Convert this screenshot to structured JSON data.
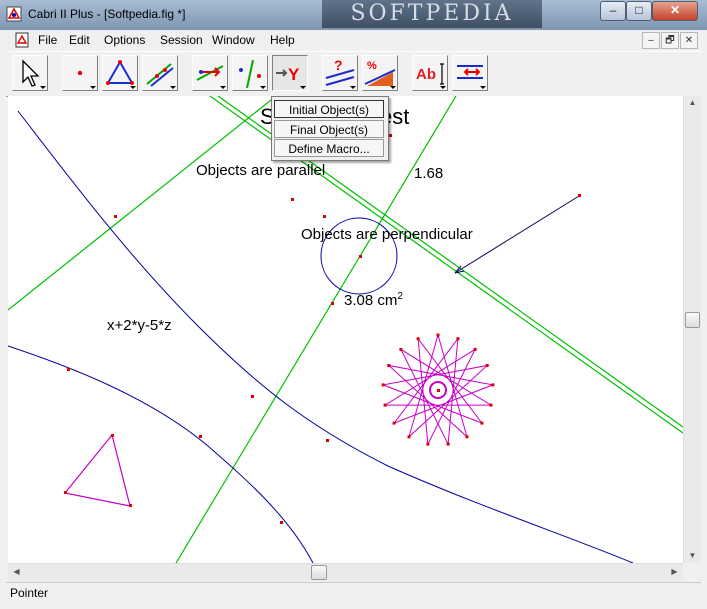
{
  "window": {
    "title": "Cabri II Plus - [Softpedia.fig *]",
    "watermark": "SOFTPEDIA",
    "controls": {
      "minimize": "–",
      "maximize": "□",
      "close": "✕"
    }
  },
  "menubar": {
    "items": [
      "File",
      "Edit",
      "Options",
      "Session",
      "Window",
      "Help"
    ],
    "mdi_controls": [
      "–",
      "🗗",
      "✕"
    ]
  },
  "toolbar": {
    "tools": [
      "pointer",
      "points",
      "lines",
      "curves",
      "constructions",
      "transformations",
      "macro",
      "check-property",
      "measure",
      "display",
      "drawing"
    ],
    "macro_menu": [
      "Initial Object(s)",
      "Final Object(s)",
      "Define Macro..."
    ]
  },
  "canvas": {
    "title_partial_left": "S",
    "title_partial_right": "est",
    "labels": {
      "parallel": "Objects are parallel",
      "perpendicular": "Objects are perpendicular",
      "distance": "1.68",
      "area_value": "3.08 cm",
      "area_exponent": "2",
      "equation": "x+2*y-5*z"
    },
    "colors": {
      "green": "#00c000",
      "blue": "#0000a0",
      "magenta": "#c800c8",
      "navy": "#000060",
      "point": "#e00000"
    }
  },
  "statusbar": {
    "text": "Pointer"
  }
}
